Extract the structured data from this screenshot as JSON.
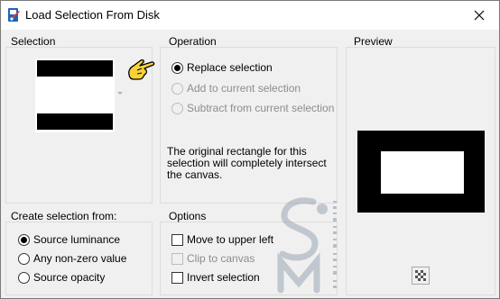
{
  "window": {
    "title": "Load Selection From Disk"
  },
  "selection_group": {
    "label": "Selection"
  },
  "operation_group": {
    "label": "Operation",
    "options": [
      {
        "label": "Replace selection",
        "selected": true,
        "enabled": true
      },
      {
        "label": "Add to current selection",
        "selected": false,
        "enabled": false
      },
      {
        "label": "Subtract from current selection",
        "selected": false,
        "enabled": false
      }
    ],
    "info": "The original rectangle for this selection will completely intersect the canvas."
  },
  "preview_group": {
    "label": "Preview"
  },
  "create_group": {
    "label": "Create selection from:",
    "options": [
      {
        "label": "Source luminance",
        "selected": true
      },
      {
        "label": "Any non-zero value",
        "selected": false
      },
      {
        "label": "Source opacity",
        "selected": false
      }
    ]
  },
  "options_group": {
    "label": "Options",
    "items": [
      {
        "label": "Move to upper left",
        "checked": false,
        "enabled": true
      },
      {
        "label": "Clip to canvas",
        "checked": false,
        "enabled": false
      },
      {
        "label": "Invert selection",
        "checked": false,
        "enabled": true
      }
    ]
  },
  "icons": {
    "app": "paintshop-icon",
    "close": "close-icon",
    "pointer": "pointing-hand-icon",
    "checker": "checkerboard-icon",
    "dropdown": "chevron-down-icon"
  },
  "colors": {
    "hand": "#f7d23a",
    "group_border": "#dcdcdc",
    "disabled_text": "#8d8d8d"
  }
}
